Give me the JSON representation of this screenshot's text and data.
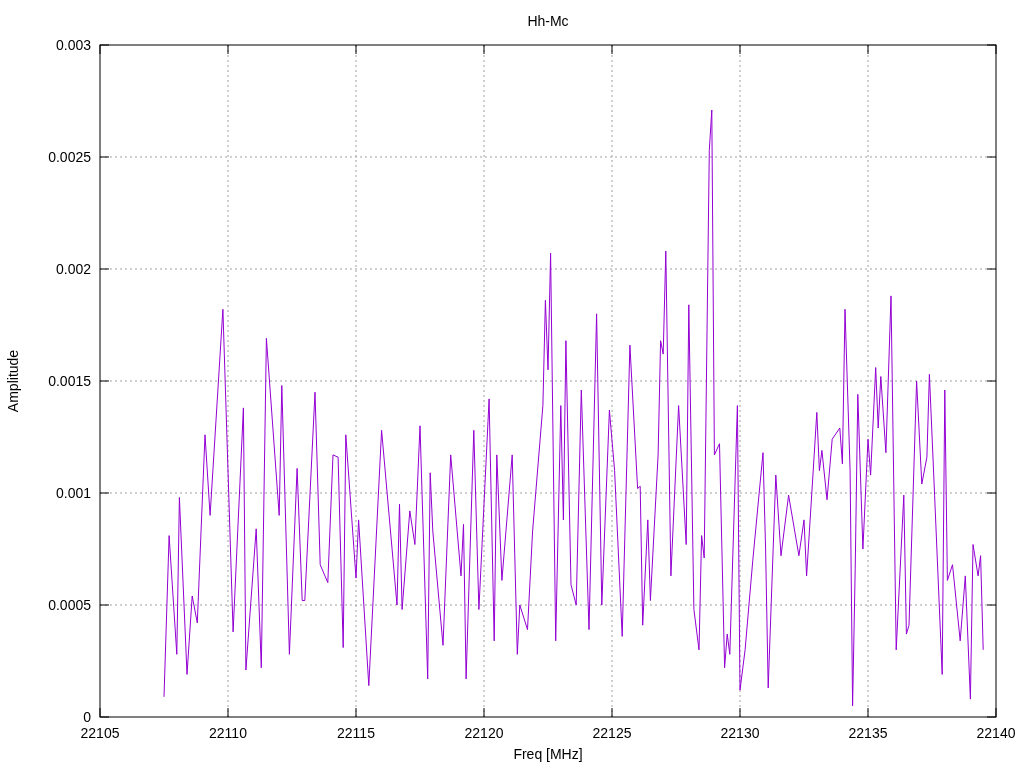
{
  "chart_data": {
    "type": "line",
    "grid": true,
    "title": "Hh-Mc",
    "xlabel": "Freq [MHz]",
    "ylabel": "Amplitude",
    "xlim": [
      22105,
      22140
    ],
    "ylim": [
      0,
      0.003
    ],
    "xticks": [
      {
        "value": 22105,
        "label": "22105"
      },
      {
        "value": 22110,
        "label": "22110"
      },
      {
        "value": 22115,
        "label": "22115"
      },
      {
        "value": 22120,
        "label": "22120"
      },
      {
        "value": 22125,
        "label": "22125"
      },
      {
        "value": 22130,
        "label": "22130"
      },
      {
        "value": 22135,
        "label": "22135"
      },
      {
        "value": 22140,
        "label": "22140"
      }
    ],
    "yticks": [
      {
        "value": 0,
        "label": "0"
      },
      {
        "value": 0.0005,
        "label": "0.0005"
      },
      {
        "value": 0.001,
        "label": "0.001"
      },
      {
        "value": 0.0015,
        "label": "0.0015"
      },
      {
        "value": 0.002,
        "label": "0.002"
      },
      {
        "value": 0.0025,
        "label": "0.0025"
      },
      {
        "value": 0.003,
        "label": "0.003"
      }
    ],
    "x": [
      22107.5,
      22107.7,
      22108.0,
      22108.1,
      22108.4,
      22108.6,
      22108.8,
      22109.1,
      22109.3,
      22109.8,
      22110.2,
      22110.6,
      22110.7,
      22111.1,
      22111.3,
      22111.5,
      22112.0,
      22112.1,
      22112.4,
      22112.7,
      22112.9,
      22113.0,
      22113.4,
      22113.6,
      22113.9,
      22114.1,
      22114.3,
      22114.5,
      22114.6,
      22115.0,
      22115.1,
      22115.5,
      22116.0,
      22116.6,
      22116.7,
      22116.8,
      22117.1,
      22117.3,
      22117.5,
      22117.8,
      22117.9,
      22118.0,
      22118.4,
      22118.7,
      22119.1,
      22119.2,
      22119.3,
      22119.6,
      22119.8,
      22120.2,
      22120.4,
      22120.5,
      22120.7,
      22121.1,
      22121.3,
      22121.4,
      22121.7,
      22121.9,
      22122.3,
      22122.4,
      22122.5,
      22122.6,
      22122.8,
      22123.0,
      22123.1,
      22123.2,
      22123.4,
      22123.6,
      22123.8,
      22124.1,
      22124.4,
      22124.6,
      22124.9,
      22125.1,
      22125.4,
      22125.7,
      22126.0,
      22126.1,
      22126.2,
      22126.4,
      22126.5,
      22126.8,
      22126.9,
      22127.0,
      22127.1,
      22127.3,
      22127.6,
      22127.9,
      22128.0,
      22128.2,
      22128.4,
      22128.5,
      22128.6,
      22128.8,
      22128.9,
      22129.0,
      22129.2,
      22129.4,
      22129.5,
      22129.6,
      22129.9,
      22130.0,
      22130.2,
      22130.5,
      22130.9,
      22131.0,
      22131.1,
      22131.4,
      22131.6,
      22131.9,
      22132.3,
      22132.5,
      22132.6,
      22132.9,
      22133.0,
      22133.1,
      22133.2,
      22133.4,
      22133.6,
      22133.9,
      22134.0,
      22134.1,
      22134.3,
      22134.4,
      22134.5,
      22134.6,
      22134.8,
      22135.0,
      22135.1,
      22135.3,
      22135.4,
      22135.5,
      22135.7,
      22135.9,
      22136.1,
      22136.4,
      22136.5,
      22136.6,
      22136.9,
      22137.1,
      22137.3,
      22137.4,
      22137.6,
      22137.9,
      22138.0,
      22138.1,
      22138.3,
      22138.6,
      22138.8,
      22139.0,
      22139.1,
      22139.3,
      22139.4,
      22139.5
    ],
    "series": [
      {
        "color": "#9400d3",
        "values": [
          9e-05,
          0.00081,
          0.00028,
          0.00098,
          0.00019,
          0.00054,
          0.00042,
          0.00126,
          0.0009,
          0.00182,
          0.00038,
          0.00138,
          0.00021,
          0.00084,
          0.00022,
          0.00169,
          0.0009,
          0.00148,
          0.00028,
          0.00111,
          0.00052,
          0.00052,
          0.00145,
          0.00068,
          0.0006,
          0.00117,
          0.00116,
          0.00031,
          0.00126,
          0.00062,
          0.00088,
          0.00014,
          0.00128,
          0.0005,
          0.00095,
          0.00048,
          0.00092,
          0.00077,
          0.0013,
          0.00017,
          0.00109,
          0.00083,
          0.00032,
          0.00117,
          0.00063,
          0.00086,
          0.00017,
          0.00128,
          0.00048,
          0.00142,
          0.00034,
          0.00117,
          0.00061,
          0.00117,
          0.00028,
          0.0005,
          0.00039,
          0.00083,
          0.00139,
          0.00186,
          0.00155,
          0.00207,
          0.00034,
          0.00139,
          0.00088,
          0.00168,
          0.00059,
          0.0005,
          0.00146,
          0.00039,
          0.0018,
          0.0005,
          0.00137,
          0.0011,
          0.00036,
          0.00166,
          0.00102,
          0.00103,
          0.00041,
          0.00088,
          0.00052,
          0.00117,
          0.00168,
          0.00162,
          0.00208,
          0.00063,
          0.00139,
          0.00077,
          0.00184,
          0.00048,
          0.0003,
          0.00081,
          0.00071,
          0.00253,
          0.00271,
          0.00117,
          0.00122,
          0.00022,
          0.00037,
          0.00028,
          0.00139,
          0.00012,
          0.0003,
          0.0007,
          0.00118,
          0.00075,
          0.00013,
          0.00108,
          0.00072,
          0.00099,
          0.00072,
          0.00088,
          0.00063,
          0.00117,
          0.00136,
          0.0011,
          0.00119,
          0.00097,
          0.00124,
          0.00129,
          0.00113,
          0.00182,
          0.0011,
          5e-05,
          0.00066,
          0.00144,
          0.00075,
          0.00124,
          0.00108,
          0.00156,
          0.00129,
          0.00152,
          0.00118,
          0.00188,
          0.0003,
          0.00099,
          0.00037,
          0.00041,
          0.0015,
          0.00104,
          0.00116,
          0.00153,
          0.00099,
          0.00019,
          0.00146,
          0.00061,
          0.00068,
          0.00034,
          0.00063,
          8e-05,
          0.00077,
          0.00063,
          0.00072,
          0.0003
        ]
      }
    ]
  }
}
